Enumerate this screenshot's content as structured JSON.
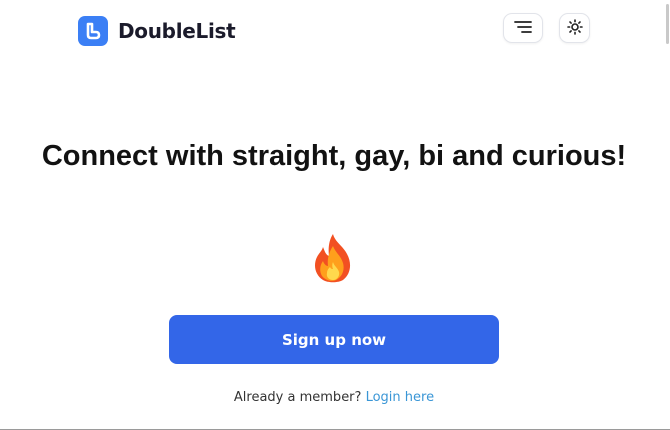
{
  "header": {
    "brand_name": "DoubleList",
    "menu_icon": "hamburger-menu-icon",
    "theme_icon": "sun-icon"
  },
  "main": {
    "headline": "Connect with straight, gay, bi and curious!",
    "emoji_icon": "fire-icon",
    "signup_label": "Sign up now",
    "member_prompt": "Already a member?",
    "login_label": "Login here"
  },
  "colors": {
    "brand_blue": "#3b7ff5",
    "button_blue": "#3366e8",
    "link_blue": "#3a96d6",
    "text_dark": "#121212"
  }
}
